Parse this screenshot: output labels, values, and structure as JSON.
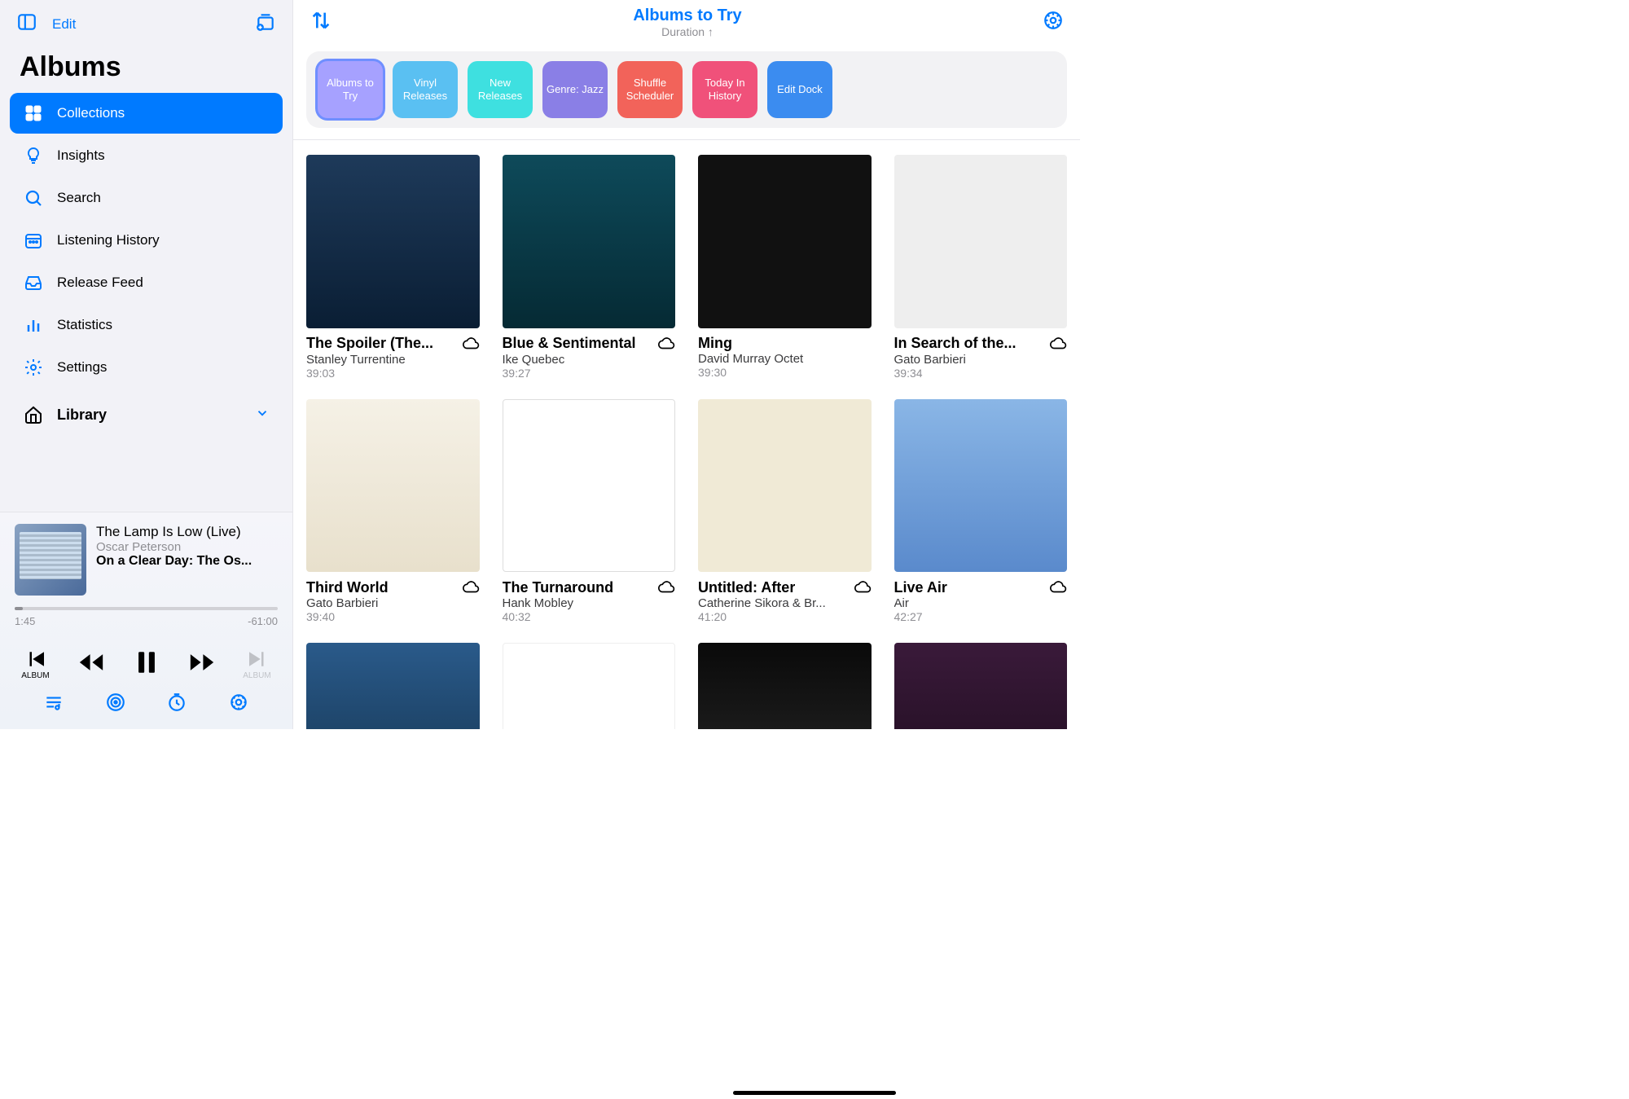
{
  "sidebar": {
    "edit": "Edit",
    "title": "Albums",
    "items": [
      {
        "icon": "grid",
        "label": "Collections"
      },
      {
        "icon": "bulb",
        "label": "Insights"
      },
      {
        "icon": "search",
        "label": "Search"
      },
      {
        "icon": "calendar",
        "label": "Listening History"
      },
      {
        "icon": "tray",
        "label": "Release Feed"
      },
      {
        "icon": "bars",
        "label": "Statistics"
      },
      {
        "icon": "gear",
        "label": "Settings"
      }
    ],
    "library": "Library"
  },
  "player": {
    "track": "The Lamp Is Low (Live)",
    "artist": "Oscar Peterson",
    "album": "On a Clear Day: The Os...",
    "elapsed": "1:45",
    "remaining": "-61:00",
    "prev_album_label": "ALBUM",
    "next_album_label": "ALBUM"
  },
  "header": {
    "title": "Albums to Try",
    "subtitle": "Duration ↑"
  },
  "dock": [
    {
      "label": "Albums to Try",
      "color": "#a6a1ff",
      "sel": true
    },
    {
      "label": "Vinyl Releases",
      "color": "#5ac0f2"
    },
    {
      "label": "New Releases",
      "color": "#3ee0e0"
    },
    {
      "label": "Genre: Jazz",
      "color": "#8a7fe6"
    },
    {
      "label": "Shuffle Scheduler",
      "color": "#f2635a"
    },
    {
      "label": "Today In History",
      "color": "#f0517a"
    },
    {
      "label": "Edit Dock",
      "color": "#3b8cf0"
    }
  ],
  "albums": [
    {
      "title": "The Spoiler (The...",
      "artist": "Stanley Turrentine",
      "dur": "39:03",
      "cloud": true,
      "art": "a"
    },
    {
      "title": "Blue & Sentimental",
      "artist": "Ike Quebec",
      "dur": "39:27",
      "cloud": true,
      "art": "b"
    },
    {
      "title": "Ming",
      "artist": "David Murray Octet",
      "dur": "39:30",
      "cloud": false,
      "art": "c"
    },
    {
      "title": "In Search of the...",
      "artist": "Gato Barbieri",
      "dur": "39:34",
      "cloud": true,
      "art": "d"
    },
    {
      "title": "Third World",
      "artist": "Gato Barbieri",
      "dur": "39:40",
      "cloud": true,
      "art": "e"
    },
    {
      "title": "The Turnaround",
      "artist": "Hank Mobley",
      "dur": "40:32",
      "cloud": true,
      "art": "f"
    },
    {
      "title": "Untitled: After",
      "artist": "Catherine Sikora & Br...",
      "dur": "41:20",
      "cloud": true,
      "art": "g"
    },
    {
      "title": "Live Air",
      "artist": "Air",
      "dur": "42:27",
      "cloud": true,
      "art": "h"
    },
    {
      "title": "",
      "artist": "",
      "dur": "",
      "cloud": false,
      "art": "i"
    },
    {
      "title": "",
      "artist": "",
      "dur": "",
      "cloud": false,
      "art": "j"
    },
    {
      "title": "",
      "artist": "",
      "dur": "",
      "cloud": false,
      "art": "k"
    },
    {
      "title": "",
      "artist": "",
      "dur": "",
      "cloud": false,
      "art": "l"
    }
  ]
}
